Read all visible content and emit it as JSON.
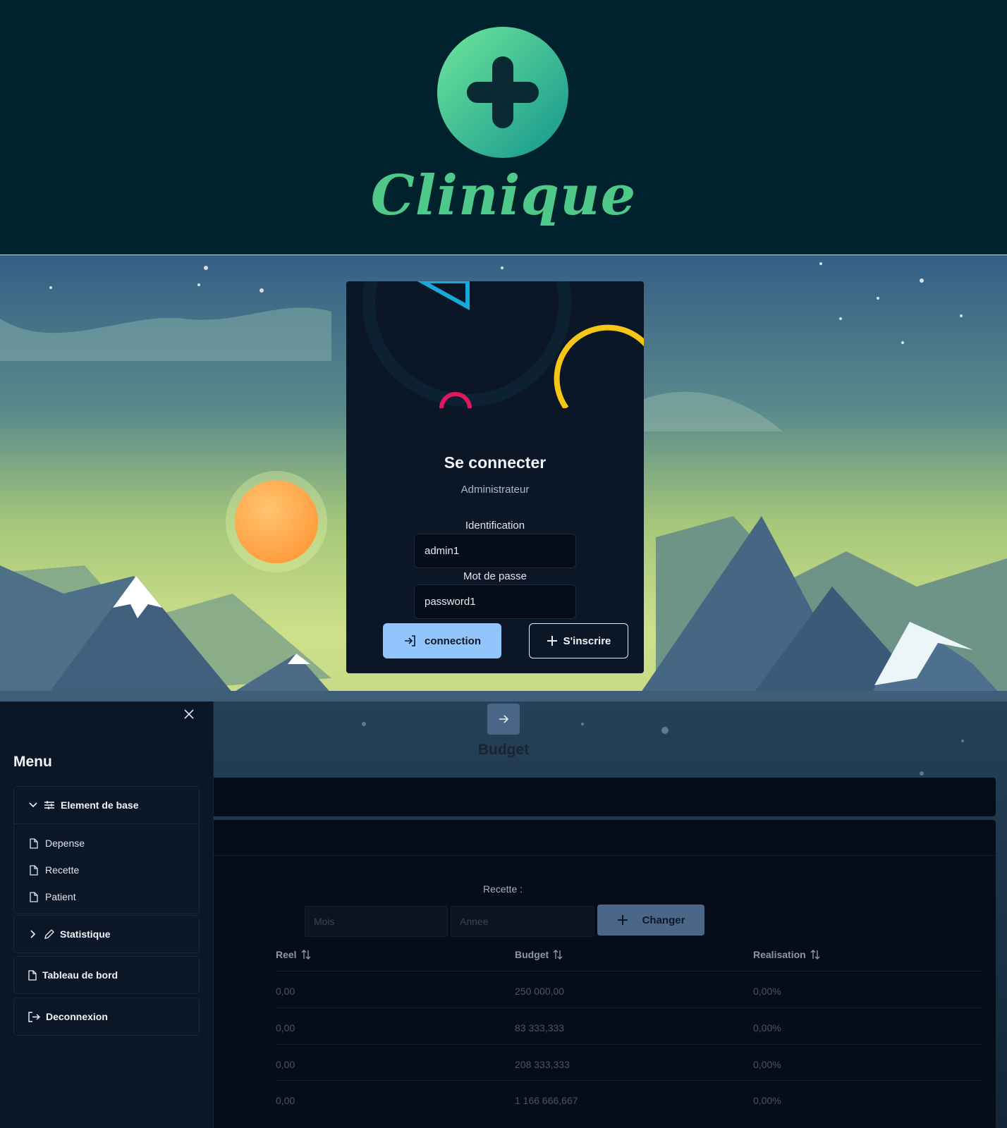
{
  "logo": {
    "brand_name": "Clinique",
    "icon": "plus-cross-icon",
    "colors": {
      "gradient_start": "#6ee69a",
      "gradient_end": "#14968f",
      "header_bg": "#00222d"
    }
  },
  "login": {
    "title": "Se connecter",
    "subtitle": "Administrateur",
    "identification_label": "Identification",
    "identification_value": "admin1",
    "password_label": "Mot de passe",
    "password_value": "password1",
    "connect_button": "connection",
    "connect_icon": "sign-in-icon",
    "signup_button": "S'inscrire",
    "signup_icon": "plus-icon",
    "colors": {
      "card_bg": "#0b1626",
      "primary": "#93c5fd"
    }
  },
  "sidebar": {
    "title": "Menu",
    "close_icon": "close-icon",
    "groups": [
      {
        "label": "Element de base",
        "expanded": true,
        "icon": "sliders-icon",
        "items": [
          {
            "label": "Depense",
            "icon": "file-icon"
          },
          {
            "label": "Recette",
            "icon": "file-icon"
          },
          {
            "label": "Patient",
            "icon": "file-icon"
          }
        ]
      },
      {
        "label": "Statistique",
        "expanded": false,
        "icon": "pencil-icon"
      },
      {
        "label": "Tableau de bord",
        "icon": "file-icon"
      },
      {
        "label": "Deconnexion",
        "icon": "sign-out-icon"
      }
    ]
  },
  "budget": {
    "toggle_icon": "arrow-right-icon",
    "title": "Budget",
    "filter_label": "Recette :",
    "month_placeholder": "Mois",
    "year_placeholder": "Annee",
    "change_button": "Changer",
    "columns": [
      "Reel",
      "Budget",
      "Realisation"
    ],
    "sort_icon": "sort-icon",
    "rows": [
      {
        "reel": "0,00",
        "budget": "250 000,00",
        "realisation": "0,00%"
      },
      {
        "reel": "0,00",
        "budget": "83 333,333",
        "realisation": "0,00%"
      },
      {
        "reel": "0,00",
        "budget": "208 333,333",
        "realisation": "0,00%"
      },
      {
        "reel": "0,00",
        "budget": "1 166 666,667",
        "realisation": "0,00%"
      }
    ]
  }
}
